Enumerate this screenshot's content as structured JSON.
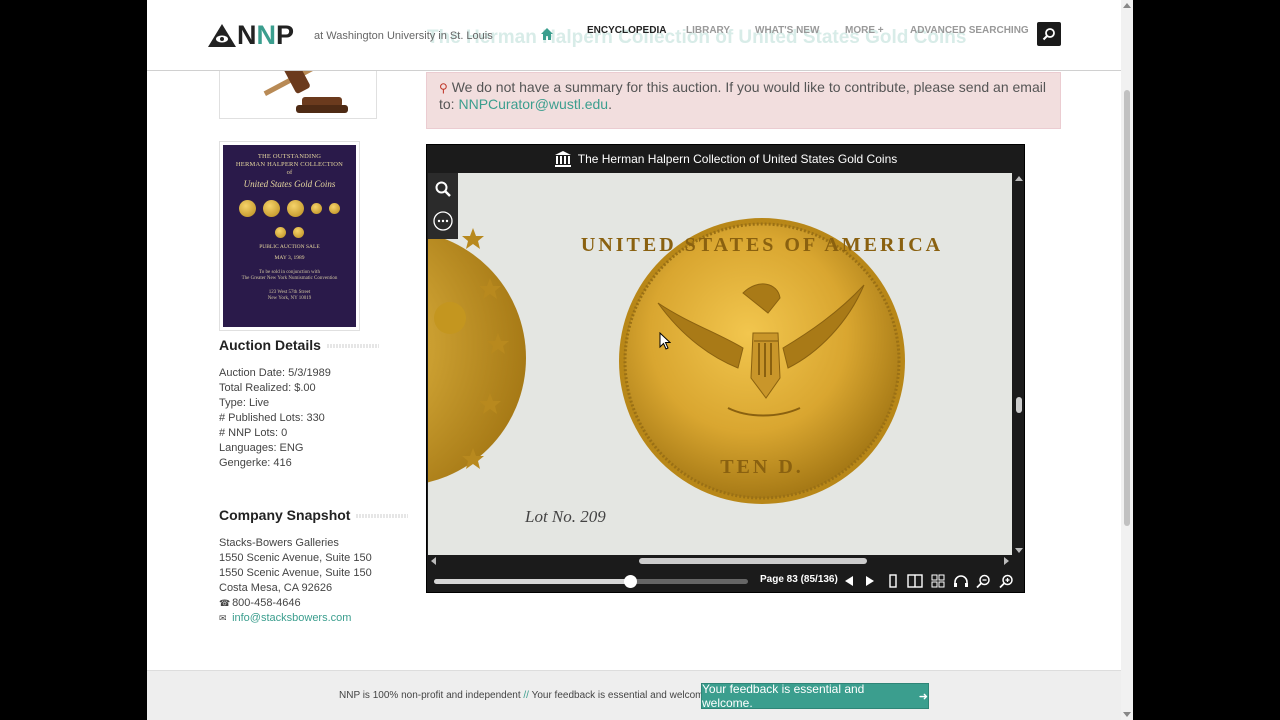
{
  "header": {
    "logo_text_n1": "N",
    "logo_text_n2": "N",
    "logo_text_p": "P",
    "tagline": "at Washington University in St. Louis",
    "faded_title": "The Herman Halpern Collection of United States Gold Coins",
    "nav": {
      "home_icon": "home-icon",
      "encyclopedia": "ENCYCLOPEDIA",
      "library": "LIBRARY",
      "whats_new": "WHAT'S NEW",
      "more": "MORE +",
      "advanced": "ADVANCED SEARCHING"
    },
    "search_icon": "search-icon"
  },
  "sidebar": {
    "cover": {
      "line1": "THE OUTSTANDING",
      "line2": "HERMAN HALPERN COLLECTION",
      "line3": "of",
      "line4": "United States Gold Coins",
      "line5": "PUBLIC AUCTION SALE",
      "line6": "MAY 3, 1989",
      "line7": "To be sold in conjunction with",
      "line8": "The Greater New York Numismatic Convention",
      "line9": "123 West 57th Street",
      "line10": "New York, NY 10019"
    },
    "auction_details": {
      "title": "Auction Details",
      "rows": [
        "Auction Date: 5/3/1989",
        "Total Realized: $.00",
        "Type: Live",
        "# Published Lots: 330",
        "# NNP Lots: 0",
        "Languages: ENG",
        "Gengerke: 416"
      ]
    },
    "company": {
      "title": "Company Snapshot",
      "name": "Stacks-Bowers Galleries",
      "addr1": "1550 Scenic Avenue, Suite 150",
      "addr2": "1550 Scenic Avenue, Suite 150",
      "city": "Costa Mesa, CA 92626",
      "phone": "800-458-4646",
      "email": "info@stacksbowers.com"
    }
  },
  "alert": {
    "text": "We do not have a summary for this auction. If you would like to contribute, please send an email to:",
    "email": "NNPCurator@wustl.edu",
    "end": "."
  },
  "viewer": {
    "title": "The Herman Halpern Collection of United States Gold Coins",
    "lot_text": "Lot No. 209",
    "coin_legend_top": "UNITED STATES OF AMERICA",
    "coin_denomination": "TEN D.",
    "page_label": "Page 83 (85/136)",
    "progress": 0.625
  },
  "footer": {
    "text1": "NNP is 100% non-profit and independent",
    "sep": "//",
    "text2": "Your feedback is essential and welcome.",
    "button": "Your feedback is essential and welcome."
  },
  "colors": {
    "accent": "#3b9e8e",
    "alert_bg": "#f2dede",
    "viewer_bg": "#1b1b1b"
  }
}
